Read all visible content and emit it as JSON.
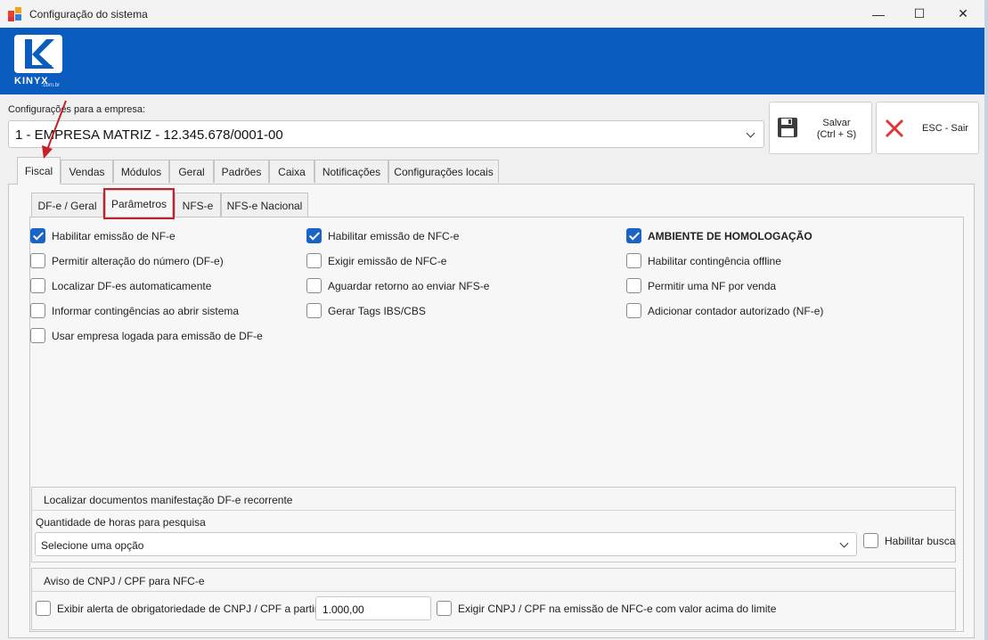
{
  "window": {
    "title": "Configuração do sistema",
    "minimize": "—",
    "maximize": "☐",
    "close": "✕"
  },
  "brand": {
    "name": "KINYX",
    "sub": ".com.br"
  },
  "company": {
    "label": "Configurações para a empresa:",
    "value": "1 - EMPRESA MATRIZ - 12.345.678/0001-00"
  },
  "actions": {
    "save_label_1": "Salvar",
    "save_label_2": "(Ctrl + S)",
    "exit_label": "ESC - Sair"
  },
  "tabs": [
    "Fiscal",
    "Vendas",
    "Módulos",
    "Geral",
    "Padrões",
    "Caixa",
    "Notificações",
    "Configurações locais"
  ],
  "active_tab": "Fiscal",
  "subtabs": [
    "DF-e / Geral",
    "Parâmetros",
    "NFS-e",
    "NFS-e Nacional"
  ],
  "active_subtab": "Parâmetros",
  "options": {
    "col1": [
      {
        "label": "Habilitar emissão de NF-e",
        "checked": true
      },
      {
        "label": "Permitir alteração do número (DF-e)",
        "checked": false
      },
      {
        "label": "Localizar DF-es automaticamente",
        "checked": false
      },
      {
        "label": "Informar contingências ao abrir sistema",
        "checked": false
      },
      {
        "label": "Usar empresa logada para emissão de DF-e",
        "checked": false
      }
    ],
    "col2": [
      {
        "label": "Habilitar emissão de NFC-e",
        "checked": true
      },
      {
        "label": "Exigir emissão de NFC-e",
        "checked": false
      },
      {
        "label": "Aguardar retorno ao enviar NFS-e",
        "checked": false
      },
      {
        "label": "Gerar Tags IBS/CBS",
        "checked": false
      }
    ],
    "col3": [
      {
        "label": "AMBIENTE DE HOMOLOGAÇÃO",
        "checked": true
      },
      {
        "label": "Habilitar contingência offline",
        "checked": false
      },
      {
        "label": "Permitir uma NF por venda",
        "checked": false
      },
      {
        "label": "Adicionar contador autorizado (NF-e)",
        "checked": false
      }
    ]
  },
  "manifest": {
    "title": "Localizar documentos manifestação DF-e recorrente",
    "hours_label": "Quantidade de horas para pesquisa",
    "hours_value": "Selecione uma opção",
    "enable_search": "Habilitar busca"
  },
  "cpf": {
    "title": "Aviso de CNPJ / CPF para NFC-e",
    "alert_label": "Exibir alerta de obrigatoriedade de CNPJ / CPF a partir de:",
    "alert_value": "1.000,00",
    "require_label": "Exigir CNPJ / CPF na emissão de NFC-e com valor acima do limite"
  },
  "colors": {
    "banner": "#0a5cbe",
    "check": "#1a64c8",
    "highlight": "#c3222a",
    "exit_x": "#e0363b"
  },
  "icons": [
    "app-icon",
    "floppy-disk-icon",
    "close-x-icon",
    "chevron-down-icon",
    "arrow-annotation"
  ]
}
